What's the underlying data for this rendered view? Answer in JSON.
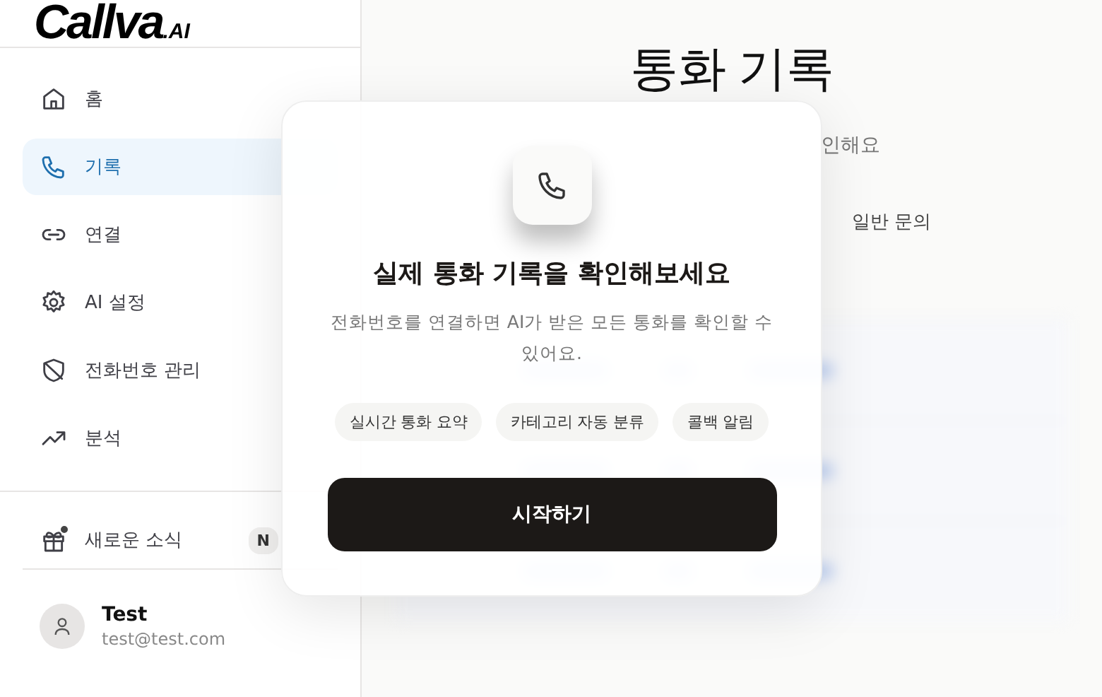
{
  "logo": {
    "name": "Callva",
    "suffix": ".AI"
  },
  "nav": [
    {
      "label": "홈",
      "selected": false
    },
    {
      "label": "기록",
      "selected": true
    },
    {
      "label": "연결",
      "selected": false
    },
    {
      "label": "AI 설정",
      "selected": false
    },
    {
      "label": "전화번호 관리",
      "selected": false
    },
    {
      "label": "분석",
      "selected": false
    }
  ],
  "news": {
    "label": "새로운 소식",
    "badge": "N",
    "unread": true
  },
  "user": {
    "name": "Test",
    "email": "test@test.com"
  },
  "page": {
    "title": "통화 기록",
    "subtitle": "인해요",
    "tab": "일반 문의"
  },
  "modal": {
    "heading": "실제 통화 기록을 확인해보세요",
    "description": "전화번호를 연결하면 AI가 받은 모든 통화를 확인할 수 있어요.",
    "chips": [
      "실시간 통화 요약",
      "카테고리 자동 분류",
      "콜백 알림"
    ],
    "button": "시작하기"
  }
}
